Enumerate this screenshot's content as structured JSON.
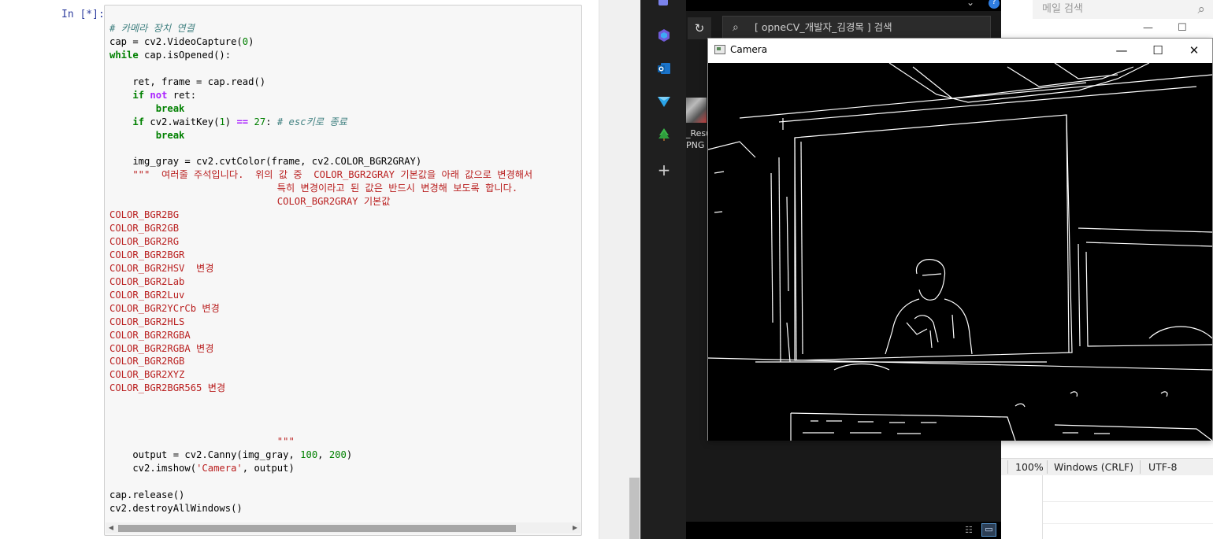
{
  "notebook": {
    "prompt": "In [*]:",
    "code_lines": [
      [
        {
          "t": "# 카메라 장치 연결",
          "c": "cm"
        }
      ],
      [
        {
          "t": "cap = cv2.VideoCapture(",
          "c": ""
        },
        {
          "t": "0",
          "c": "nm"
        },
        {
          "t": ")",
          "c": ""
        }
      ],
      [
        {
          "t": "while",
          "c": "kw"
        },
        {
          "t": " cap.isOpened():",
          "c": ""
        }
      ],
      [],
      [
        {
          "t": "    ret, frame = cap.read()",
          "c": ""
        }
      ],
      [
        {
          "t": "    ",
          "c": ""
        },
        {
          "t": "if",
          "c": "kw"
        },
        {
          "t": " ",
          "c": ""
        },
        {
          "t": "not",
          "c": "op"
        },
        {
          "t": " ret:",
          "c": ""
        }
      ],
      [
        {
          "t": "        ",
          "c": ""
        },
        {
          "t": "break",
          "c": "kw"
        }
      ],
      [
        {
          "t": "    ",
          "c": ""
        },
        {
          "t": "if",
          "c": "kw"
        },
        {
          "t": " cv2.waitKey(",
          "c": ""
        },
        {
          "t": "1",
          "c": "nm"
        },
        {
          "t": ") ",
          "c": ""
        },
        {
          "t": "==",
          "c": "op"
        },
        {
          "t": " ",
          "c": ""
        },
        {
          "t": "27",
          "c": "nm"
        },
        {
          "t": ": ",
          "c": ""
        },
        {
          "t": "# esc키로 종료",
          "c": "cm"
        }
      ],
      [
        {
          "t": "        ",
          "c": ""
        },
        {
          "t": "break",
          "c": "kw"
        }
      ],
      [],
      [
        {
          "t": "    img_gray = cv2.cvtColor(frame, cv2.COLOR_BGR2GRAY)",
          "c": ""
        }
      ],
      [
        {
          "t": "    \"\"\"  여러줄 주석입니다.  위의 값 중  COLOR_BGR2GRAY 기본값을 아래 값으로 변경해서",
          "c": "str"
        }
      ],
      [
        {
          "t": "                             특히 변경이라고 된 값은 반드시 변경해 보도록 합니다.",
          "c": "str"
        }
      ],
      [
        {
          "t": "                             COLOR_BGR2GRAY 기본값",
          "c": "str"
        }
      ],
      [
        {
          "t": "COLOR_BGR2BG",
          "c": "str"
        }
      ],
      [
        {
          "t": "COLOR_BGR2GB",
          "c": "str"
        }
      ],
      [
        {
          "t": "COLOR_BGR2RG",
          "c": "str"
        }
      ],
      [
        {
          "t": "COLOR_BGR2BGR",
          "c": "str"
        }
      ],
      [
        {
          "t": "COLOR_BGR2HSV  변경",
          "c": "str"
        }
      ],
      [
        {
          "t": "COLOR_BGR2Lab",
          "c": "str"
        }
      ],
      [
        {
          "t": "COLOR_BGR2Luv",
          "c": "str"
        }
      ],
      [
        {
          "t": "COLOR_BGR2YCrCb 변경",
          "c": "str"
        }
      ],
      [
        {
          "t": "COLOR_BGR2HLS",
          "c": "str"
        }
      ],
      [
        {
          "t": "COLOR_BGR2RGBA",
          "c": "str"
        }
      ],
      [
        {
          "t": "COLOR_BGR2RGBA 변경",
          "c": "str"
        }
      ],
      [
        {
          "t": "COLOR_BGR2RGB",
          "c": "str"
        }
      ],
      [
        {
          "t": "COLOR_BGR2XYZ",
          "c": "str"
        }
      ],
      [
        {
          "t": "COLOR_BGR2BGR565 변경",
          "c": "str"
        }
      ],
      [],
      [],
      [],
      [
        {
          "t": "                             \"\"\"",
          "c": "str"
        }
      ],
      [
        {
          "t": "    output = cv2.Canny(img_gray, ",
          "c": ""
        },
        {
          "t": "100",
          "c": "nm"
        },
        {
          "t": ", ",
          "c": ""
        },
        {
          "t": "200",
          "c": "nm"
        },
        {
          "t": ")",
          "c": ""
        }
      ],
      [
        {
          "t": "    cv2.imshow(",
          "c": ""
        },
        {
          "t": "'Camera'",
          "c": "str"
        },
        {
          "t": ", output)",
          "c": ""
        }
      ],
      [],
      [
        {
          "t": "cap.release()",
          "c": ""
        }
      ],
      [
        {
          "t": "cv2.destroyAllWindows()",
          "c": ""
        }
      ]
    ],
    "scroll_left": "◀",
    "scroll_right": "▶"
  },
  "explorer": {
    "search_placeholder": "[ opneCV_개발자_김경목 ] 검색",
    "refresh_icon": "refresh-icon",
    "file_name_line1": "_Resu",
    "file_name_line2": "PNG",
    "partial_label": "H"
  },
  "right_app": {
    "mail_search_placeholder": "메일 검색",
    "status_zoom": "100%",
    "status_line_ending": "Windows (CRLF)",
    "status_encoding": "UTF-8"
  },
  "camera_window": {
    "title": "Camera"
  },
  "colors": {
    "accent_blue": "#303f9f",
    "keyword_green": "#008000",
    "string_red": "#ba2121",
    "comment_teal": "#408080"
  }
}
